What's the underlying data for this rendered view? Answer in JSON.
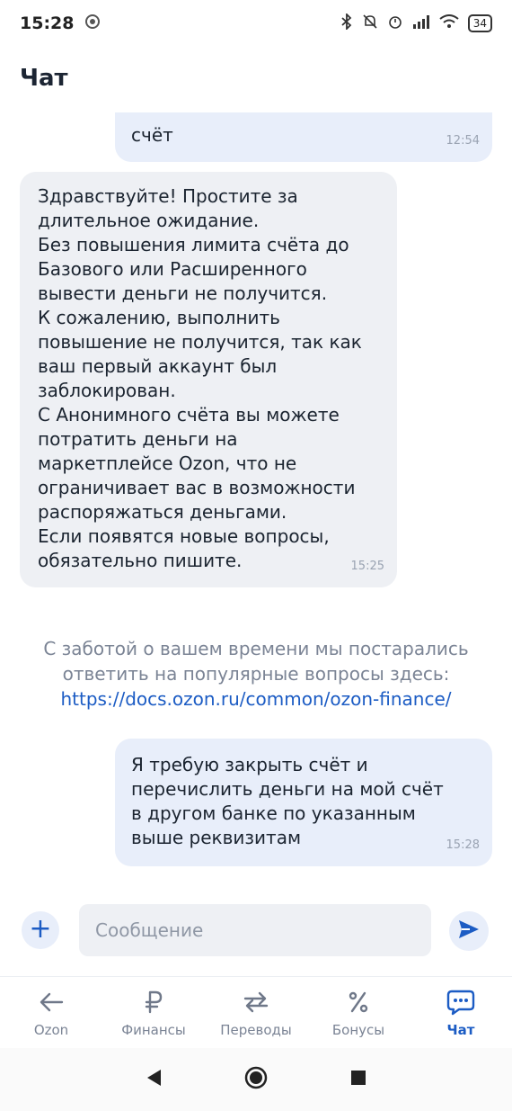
{
  "status_bar": {
    "time": "15:28",
    "battery": "34"
  },
  "header": {
    "title": "Чат"
  },
  "messages": [
    {
      "text": "счёт",
      "time": "12:54"
    },
    {
      "text": "Здравствуйте! Простите за\nдлительное ожидание.\nБез повышения лимита счёта до\nБазового или Расширенного\nвывести деньги не получится.\nК сожалению, выполнить\nповышение не получится, так как\nваш первый аккаунт был\nзаблокирован.\nС Анонимного счёта вы можете\nпотратить деньги на\nмаркетплейсе Ozon, что не\nограничивает вас в возможности\nраспоряжаться деньгами.\nЕсли появятся новые вопросы,\nобязательно пишите.",
      "time": "15:25"
    },
    {
      "text": "Я требую закрыть счёт и\nперечислить деньги на мой счёт\nв другом банке по указанным\nвыше реквизитам",
      "time": "15:28"
    }
  ],
  "info": {
    "line1": "С заботой о вашем времени мы постарались",
    "line2": "ответить на популярные вопросы здесь:",
    "link": "https://docs.ozon.ru/common/ozon-finance/"
  },
  "composer": {
    "add_label": "+",
    "placeholder": "Сообщение"
  },
  "tabs": [
    {
      "label": "Ozon",
      "icon": "arrow-left-icon"
    },
    {
      "label": "Финансы",
      "icon": "ruble-icon"
    },
    {
      "label": "Переводы",
      "icon": "transfer-icon"
    },
    {
      "label": "Бонусы",
      "icon": "percent-icon"
    },
    {
      "label": "Чат",
      "icon": "chat-icon",
      "active": true
    }
  ],
  "colors": {
    "accent": "#1c5cc4",
    "bubble_out": "#e8eefa",
    "bubble_in": "#eef0f4"
  }
}
